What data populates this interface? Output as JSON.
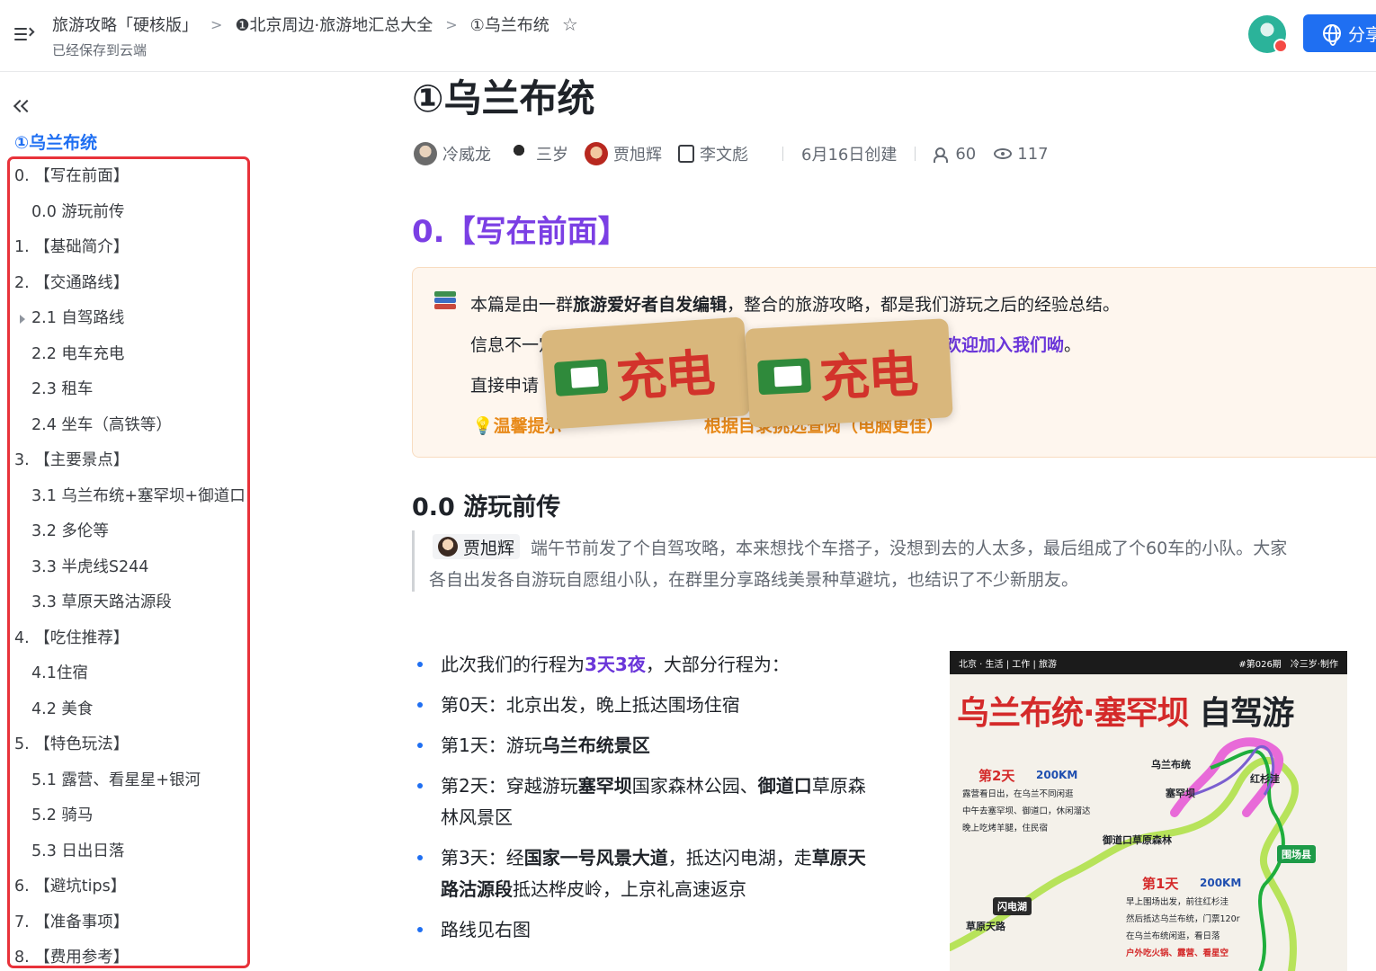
{
  "breadcrumb": {
    "items": [
      "旅游攻略「硬核版」",
      "❶北京周边·旅游地汇总大全",
      "①乌兰布统"
    ],
    "saved_status": "已经保存到云端"
  },
  "share_button": {
    "label": "分享"
  },
  "outline": {
    "title": "①乌兰布统",
    "items": [
      {
        "label": "0. 【写在前面】",
        "level": 1
      },
      {
        "label": "0.0 游玩前传",
        "level": 2
      },
      {
        "label": "1. 【基础简介】",
        "level": 1
      },
      {
        "label": "2. 【交通路线】",
        "level": 1
      },
      {
        "label": "2.1 自驾路线",
        "level": 2,
        "collapsible": true
      },
      {
        "label": "2.2 电车充电",
        "level": 2
      },
      {
        "label": "2.3 租车",
        "level": 2
      },
      {
        "label": "2.4 坐车（高铁等）",
        "level": 2
      },
      {
        "label": "3. 【主要景点】",
        "level": 1
      },
      {
        "label": "3.1 乌兰布统+塞罕坝+御道口",
        "level": 2
      },
      {
        "label": "3.2 多伦等",
        "level": 2
      },
      {
        "label": "3.3 半虎线S244",
        "level": 2
      },
      {
        "label": "3.3 草原天路沽源段",
        "level": 2
      },
      {
        "label": "4. 【吃住推荐】",
        "level": 1
      },
      {
        "label": "4.1住宿",
        "level": 2
      },
      {
        "label": "4.2 美食",
        "level": 2
      },
      {
        "label": "5. 【特色玩法】",
        "level": 1
      },
      {
        "label": "5.1 露营、看星星+银河",
        "level": 2
      },
      {
        "label": "5.2 骑马",
        "level": 2
      },
      {
        "label": "5.3 日出日落",
        "level": 2
      },
      {
        "label": "6. 【避坑tips】",
        "level": 1
      },
      {
        "label": "7. 【准备事项】",
        "level": 1
      },
      {
        "label": "8. 【费用参考】",
        "level": 1
      }
    ]
  },
  "doc": {
    "title": "①乌兰布统",
    "authors": [
      "冷威龙",
      "三岁",
      "贾旭辉",
      "李文彪"
    ],
    "created": "6月16日创建",
    "collaborators": "60",
    "views": "117",
    "section0_heading": "0.【写在前面】",
    "callout": {
      "line1_pre": "本篇是由一群",
      "line1_bold": "旅游爱好者自发编辑",
      "line1_post": "，整合的旅游攻略，都是我们游玩之后的经验总结。",
      "line2_pre": "信息不一定全面",
      "line2_link": "欢迎加入我们呦",
      "line2_end": "。",
      "line3_pre": "直接申请",
      "tip": "💡温馨提示",
      "tip_tail": "根据目录挑选查阅（电脑更佳）",
      "sticker_text": "充电"
    },
    "subheading": "0.0 游玩前传",
    "quote": {
      "mention": "贾旭辉",
      "line1": "端午节前发了个自驾攻略，本来想找个车搭子，没想到去的人太多，最后组成了个60车的小队。大家",
      "line2": "各自出发各自游玩自愿组小队，在群里分享路线美景种草避坑，也结识了不少新朋友。"
    },
    "bullets": {
      "b1_pre": "此次我们的行程为",
      "b1_hl": "3天3夜",
      "b1_post": "，大部分行程为：",
      "b2": "第0天：北京出发，晚上抵达围场住宿",
      "b3_pre": "第1天：游玩",
      "b3_bold": "乌兰布统景区",
      "b4_pre": "第2天：穿越游玩",
      "b4_bold1": "塞罕坝",
      "b4_mid": "国家森林公园、",
      "b4_bold2": "御道口",
      "b4_post": "草原森林风景区",
      "b5_pre": "第3天：经",
      "b5_bold1": "国家一号风景大道",
      "b5_mid": "，抵达闪电湖，走",
      "b5_bold2": "草原天路沽源段",
      "b5_post": "抵达桦皮岭，上京礼高速返京",
      "b6": "路线见右图"
    },
    "poster": {
      "strip_left": "北京 · 生活 | 工作 | 旅游",
      "strip_issue": "#第026期",
      "strip_right": "冷三岁·制作",
      "title_red": "乌兰布统·塞罕坝",
      "title_black": " 自驾游",
      "day2": "第2天",
      "day2_km": "200KM",
      "day2_desc": [
        "露营看日出，在乌兰不同闲逛",
        "中午去塞罕坝、御道口，休闲溜达",
        "晚上吃烤羊腿，住民宿"
      ],
      "day1": "第1天",
      "day1_km": "200KM",
      "day1_desc": [
        "早上围场出发，前往红杉洼",
        "然后抵达乌兰布统，门票120r",
        "在乌兰布统闲逛，看日落",
        "户外吃火锅、露营、看星空"
      ],
      "places": [
        "乌兰布统",
        "红杉洼",
        "塞罕坝",
        "御道口草原森林",
        "围场县",
        "闪电湖",
        "草原天路"
      ]
    }
  }
}
